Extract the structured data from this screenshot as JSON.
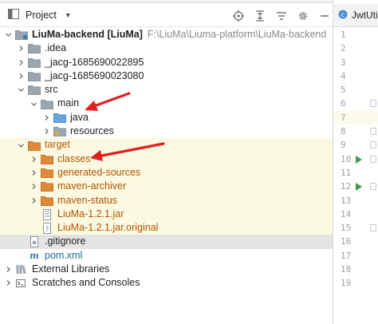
{
  "toolbar": {
    "title": "Project",
    "icons": [
      "locate-icon",
      "collapse-all-icon",
      "filter-icon",
      "gear-icon",
      "hide-icon"
    ]
  },
  "tree": [
    {
      "name": "tree-node-liuma-backend",
      "label": "LiuMa-backend [LiuMa]",
      "bold": true,
      "path": "F:\\LiuMa\\Liuma-platform\\LiuMa-backend",
      "depth": 0,
      "expanded": true,
      "icon": "module-folder",
      "style": "normal",
      "row": "normal"
    },
    {
      "name": "tree-node-idea",
      "label": ".idea",
      "depth": 1,
      "expanded": false,
      "icon": "folder",
      "style": "normal",
      "row": "normal"
    },
    {
      "name": "tree-node-jacg-1",
      "label": "_jacg-1685690022895",
      "depth": 1,
      "expanded": false,
      "icon": "folder",
      "style": "normal",
      "row": "normal"
    },
    {
      "name": "tree-node-jacg-2",
      "label": "_jacg-1685690023080",
      "depth": 1,
      "expanded": false,
      "icon": "folder",
      "style": "normal",
      "row": "normal"
    },
    {
      "name": "tree-node-src",
      "label": "src",
      "depth": 1,
      "expanded": true,
      "icon": "folder",
      "style": "normal",
      "row": "normal"
    },
    {
      "name": "tree-node-main",
      "label": "main",
      "depth": 2,
      "expanded": true,
      "icon": "folder",
      "style": "normal",
      "row": "normal"
    },
    {
      "name": "tree-node-java",
      "label": "java",
      "depth": 3,
      "expanded": false,
      "icon": "source-folder",
      "style": "normal",
      "row": "normal"
    },
    {
      "name": "tree-node-resources",
      "label": "resources",
      "depth": 3,
      "expanded": false,
      "icon": "resources-folder",
      "style": "normal",
      "row": "normal"
    },
    {
      "name": "tree-node-target",
      "label": "target",
      "depth": 1,
      "expanded": true,
      "icon": "excluded-folder",
      "style": "orange",
      "row": "excluded"
    },
    {
      "name": "tree-node-classes",
      "label": "classes",
      "depth": 2,
      "expanded": false,
      "icon": "excluded-folder",
      "style": "orange",
      "row": "excluded"
    },
    {
      "name": "tree-node-generated-sources",
      "label": "generated-sources",
      "depth": 2,
      "expanded": false,
      "icon": "excluded-folder",
      "style": "orange",
      "row": "excluded"
    },
    {
      "name": "tree-node-maven-archiver",
      "label": "maven-archiver",
      "depth": 2,
      "expanded": false,
      "icon": "excluded-folder",
      "style": "orange",
      "row": "excluded"
    },
    {
      "name": "tree-node-maven-status",
      "label": "maven-status",
      "depth": 2,
      "expanded": false,
      "icon": "excluded-folder",
      "style": "orange",
      "row": "excluded"
    },
    {
      "name": "tree-node-jar",
      "label": "LiuMa-1.2.1.jar",
      "depth": 2,
      "expanded": null,
      "icon": "jar-file",
      "style": "orange",
      "row": "excluded"
    },
    {
      "name": "tree-node-jar-original",
      "label": "LiuMa-1.2.1.jar.original",
      "depth": 2,
      "expanded": null,
      "icon": "unknown-file",
      "style": "orange",
      "row": "excluded"
    },
    {
      "name": "tree-node-gitignore",
      "label": ".gitignore",
      "depth": 1,
      "expanded": null,
      "icon": "gitignore-file",
      "style": "normal",
      "row": "selected"
    },
    {
      "name": "tree-node-pom",
      "label": "pom.xml",
      "depth": 1,
      "expanded": null,
      "icon": "maven-file",
      "style": "teal",
      "row": "normal"
    },
    {
      "name": "tree-node-external-libraries",
      "label": "External Libraries",
      "depth": 0,
      "expanded": false,
      "icon": "libraries",
      "style": "normal",
      "row": "normal"
    },
    {
      "name": "tree-node-scratches",
      "label": "Scratches and Consoles",
      "depth": 0,
      "expanded": false,
      "icon": "scratches",
      "style": "normal",
      "row": "normal"
    }
  ],
  "editor": {
    "tab_label": "JwtUtils.",
    "lines": [
      {
        "n": "1",
        "run": false,
        "fold": false,
        "hl": false
      },
      {
        "n": "2",
        "run": false,
        "fold": false,
        "hl": false
      },
      {
        "n": "3",
        "run": false,
        "fold": false,
        "hl": false
      },
      {
        "n": "4",
        "run": false,
        "fold": false,
        "hl": false
      },
      {
        "n": "5",
        "run": false,
        "fold": false,
        "hl": false
      },
      {
        "n": "6",
        "run": false,
        "fold": true,
        "hl": false
      },
      {
        "n": "7",
        "run": false,
        "fold": false,
        "hl": true
      },
      {
        "n": "8",
        "run": false,
        "fold": true,
        "hl": false
      },
      {
        "n": "9",
        "run": false,
        "fold": true,
        "hl": false
      },
      {
        "n": "10",
        "run": true,
        "fold": true,
        "hl": false
      },
      {
        "n": "11",
        "run": false,
        "fold": false,
        "hl": false
      },
      {
        "n": "12",
        "run": true,
        "fold": true,
        "hl": false
      },
      {
        "n": "13",
        "run": false,
        "fold": false,
        "hl": false
      },
      {
        "n": "14",
        "run": false,
        "fold": false,
        "hl": false
      },
      {
        "n": "15",
        "run": false,
        "fold": true,
        "hl": false
      },
      {
        "n": "16",
        "run": false,
        "fold": false,
        "hl": false
      },
      {
        "n": "17",
        "run": false,
        "fold": false,
        "hl": false
      },
      {
        "n": "18",
        "run": false,
        "fold": false,
        "hl": false
      },
      {
        "n": "19",
        "run": false,
        "fold": false,
        "hl": false
      }
    ]
  },
  "annotation": {
    "color": "#e02020",
    "arrows": [
      "arrow-to-java",
      "arrow-to-classes"
    ]
  }
}
